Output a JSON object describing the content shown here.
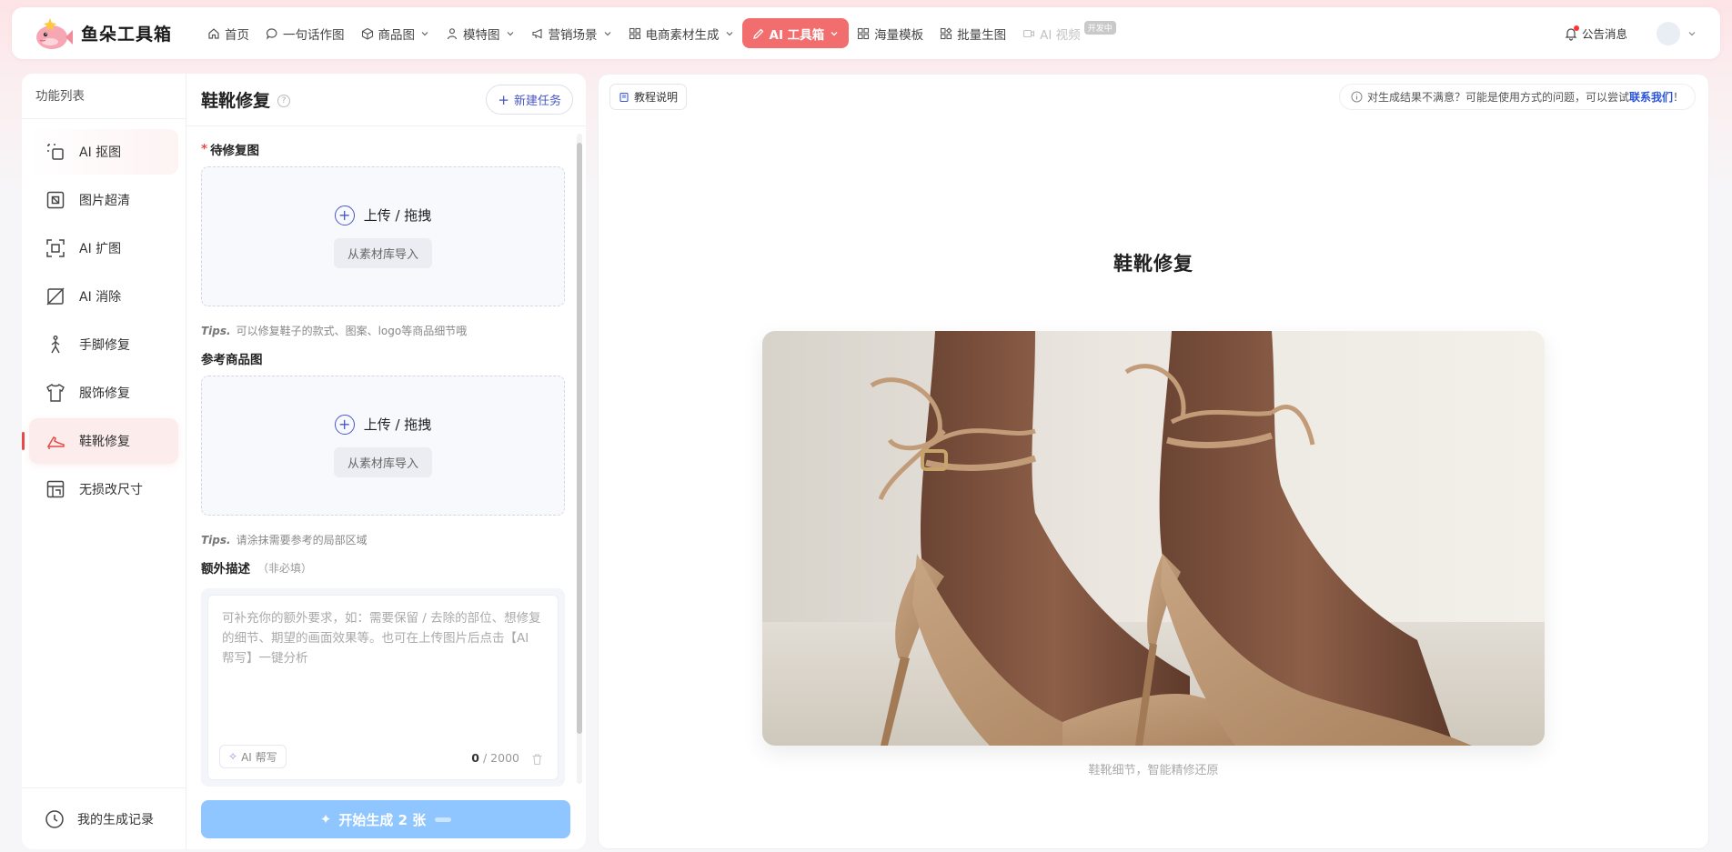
{
  "brand": {
    "name": "鱼朵工具箱"
  },
  "nav": {
    "items": [
      {
        "label": "首页",
        "icon": "home-icon",
        "chevron": false
      },
      {
        "label": "一句话作图",
        "icon": "chat-bubble-icon",
        "chevron": false
      },
      {
        "label": "商品图",
        "icon": "cube-icon",
        "chevron": true
      },
      {
        "label": "模特图",
        "icon": "person-icon",
        "chevron": true
      },
      {
        "label": "营销场景",
        "icon": "megaphone-icon",
        "chevron": true
      },
      {
        "label": "电商素材生成",
        "icon": "grid-icon",
        "chevron": true
      },
      {
        "label": "AI 工具箱",
        "icon": "pen-icon",
        "chevron": true,
        "active": true
      },
      {
        "label": "海量模板",
        "icon": "grid-icon",
        "chevron": false
      },
      {
        "label": "批量生图",
        "icon": "apps-icon",
        "chevron": false
      },
      {
        "label": "AI 视频",
        "icon": "video-icon",
        "chevron": false,
        "disabled": true,
        "badge": "开发中"
      }
    ],
    "notice_label": "公告消息"
  },
  "sidebar": {
    "title": "功能列表",
    "items": [
      {
        "label": "AI 抠图",
        "icon": "cutout-icon"
      },
      {
        "label": "图片超清",
        "icon": "sharpen-icon"
      },
      {
        "label": "AI 扩图",
        "icon": "expand-icon"
      },
      {
        "label": "AI 消除",
        "icon": "erase-icon"
      },
      {
        "label": "手脚修复",
        "icon": "figure-icon"
      },
      {
        "label": "服饰修复",
        "icon": "shirt-icon"
      },
      {
        "label": "鞋靴修复",
        "icon": "shoe-icon",
        "active": true
      },
      {
        "label": "无损改尺寸",
        "icon": "resize-icon"
      }
    ],
    "history_label": "我的生成记录"
  },
  "form": {
    "title": "鞋靴修复",
    "help": "?",
    "new_task": "新建任务",
    "section1_label": "待修复图",
    "upload_label": "上传 / 拖拽",
    "library_label": "从素材库导入",
    "tips_prefix": "Tips.",
    "tips1": "可以修复鞋子的款式、图案、logo等商品细节哦",
    "section2_label": "参考商品图",
    "tips2": "请涂抹需要参考的局部区域",
    "section3_label": "额外描述",
    "section3_optional": "（非必填）",
    "desc_placeholder": "可补充你的额外要求，如：需要保留 / 去除的部位、想修复的细节、期望的画面效果等。也可在上传图片后点击【AI 帮写】一键分析",
    "ai_write": "AI 帮写",
    "count": "0",
    "max": "/ 2000",
    "generate": "开始生成 2 张"
  },
  "preview": {
    "guide": "教程说明",
    "feedback_text": "对生成结果不满意？可能是使用方式的问题，可以尝试",
    "feedback_link": "联系我们",
    "feedback_end": "！",
    "title": "鞋靴修复",
    "caption": "鞋靴细节，智能精修还原"
  },
  "colors": {
    "accent": "#f26d6d",
    "active_bg": "#fdecec",
    "primary_blue": "#4a57c4",
    "button_disabled": "#8fc6ff",
    "link": "#2a55d8"
  }
}
